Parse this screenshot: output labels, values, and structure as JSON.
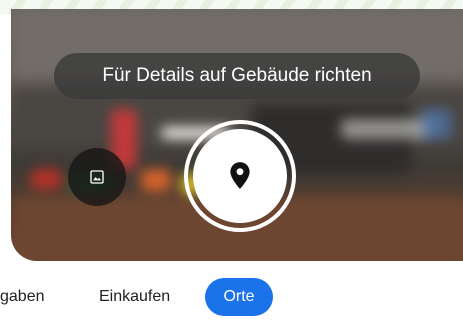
{
  "hint": {
    "text": "Für Details auf Gebäude richten"
  },
  "camera": {
    "gallery_icon": "image-icon",
    "shutter_icon": "location-pin-icon"
  },
  "chips": [
    {
      "label": "gaben",
      "selected": false
    },
    {
      "label": "Einkaufen",
      "selected": false
    },
    {
      "label": "Orte",
      "selected": true
    }
  ],
  "colors": {
    "selected_chip": "#1a73e8",
    "hint_background": "#3a3a3a"
  }
}
